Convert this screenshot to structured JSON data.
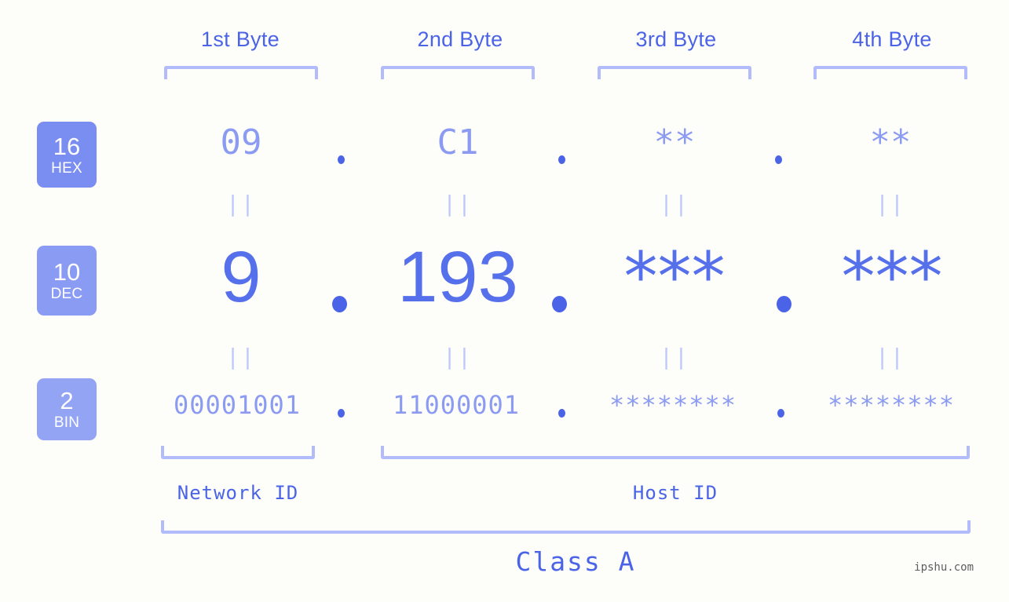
{
  "background_color": "#fdfefa",
  "accent_color": "#4a63e7",
  "muted_color": "#8c9bf2",
  "bracket_color": "#b2bcfb",
  "byte_headers": [
    {
      "label": "1st Byte"
    },
    {
      "label": "2nd Byte"
    },
    {
      "label": "3rd Byte"
    },
    {
      "label": "4th Byte"
    }
  ],
  "rows": {
    "hex": {
      "badge_number": "16",
      "badge_name": "HEX",
      "badge_color": "#7a8df0",
      "values": [
        "09",
        "C1",
        "**",
        "**"
      ],
      "separator": "."
    },
    "dec": {
      "badge_number": "10",
      "badge_name": "DEC",
      "badge_color": "#8a9bf3",
      "values": [
        "9",
        "193",
        "***",
        "***"
      ],
      "separator": "."
    },
    "bin": {
      "badge_number": "2",
      "badge_name": "BIN",
      "badge_color": "#93a4f5",
      "values": [
        "00001001",
        "11000001",
        "********",
        "********"
      ],
      "separator": "."
    }
  },
  "equality_mark": "||",
  "id_labels": {
    "network": "Network ID",
    "host": "Host ID"
  },
  "class_label": "Class A",
  "watermark": "ipshu.com"
}
